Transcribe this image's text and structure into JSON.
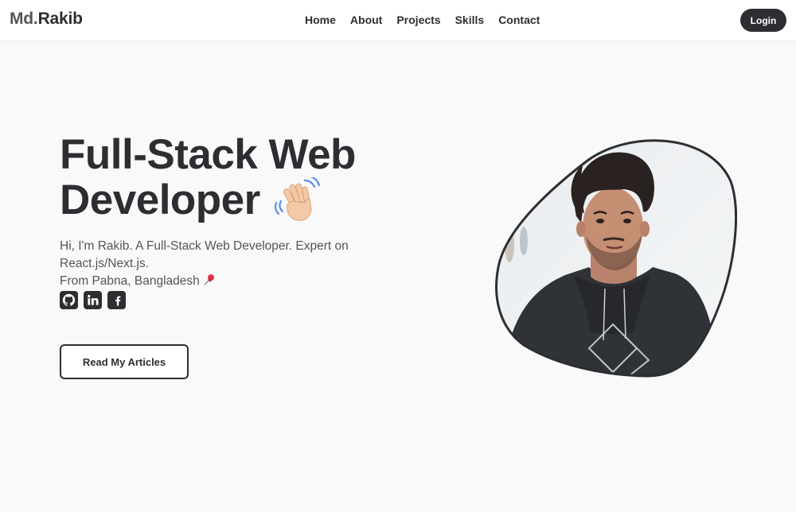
{
  "header": {
    "logo_prefix": "Md.",
    "logo_name": "Rakib",
    "nav": [
      "Home",
      "About",
      "Projects",
      "Skills",
      "Contact"
    ],
    "login_label": "Login"
  },
  "hero": {
    "title_line1": "Full-Stack Web",
    "title_line2": "Developer",
    "wave_icon": "waving-hand-icon",
    "desc_line1": "Hi, I'm Rakib. A Full-Stack Web Developer. Expert on React.js/Next.js.",
    "desc_line2": "From Pabna, Bangladesh",
    "pin_icon": "pushpin-icon",
    "socials": [
      "github-icon",
      "linkedin-icon",
      "facebook-icon"
    ],
    "articles_button": "Read My Articles",
    "portrait": "profile-photo"
  },
  "colors": {
    "text": "#2d2e32",
    "background": "#f9f9f9",
    "header_bg": "#ffffff",
    "button_dark": "#2d2e32"
  }
}
